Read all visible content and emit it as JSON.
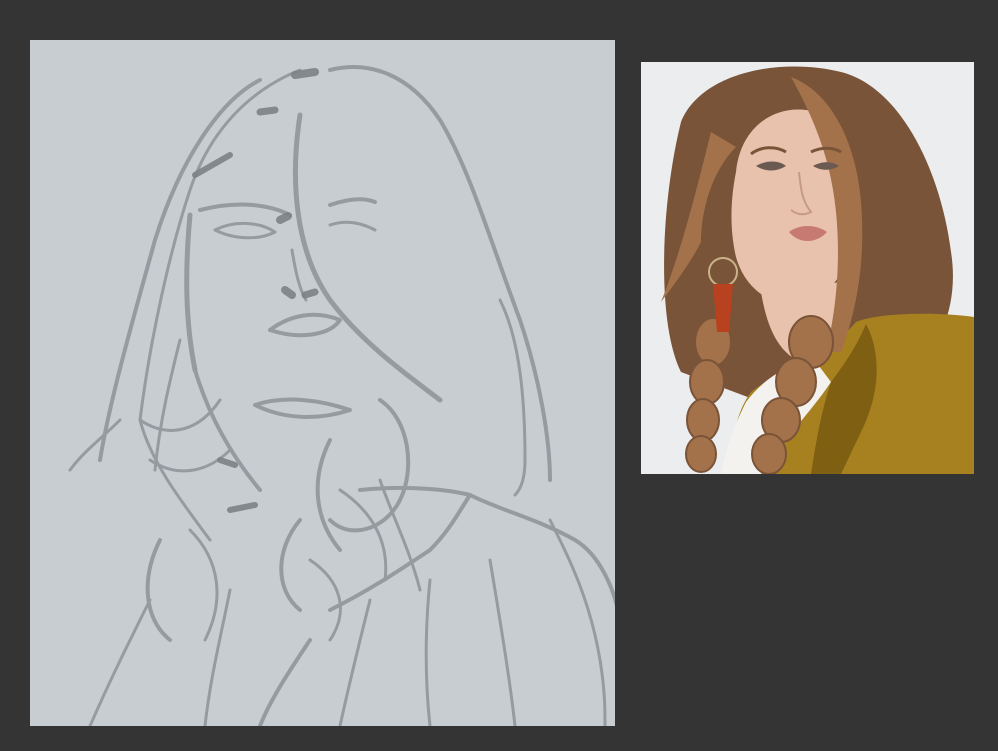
{
  "app": {
    "colors": {
      "background": "#343434",
      "canvas": "#c7cdd1",
      "sketch_stroke": "#8e9398",
      "sketch_stroke_dark": "#7d8286",
      "reference_background": "#ecedef",
      "reference_hair": "#7a5438",
      "reference_hair_light": "#a3724a",
      "reference_skin": "#e8c2ac",
      "reference_coat": "#a7801f",
      "reference_coat_shadow": "#7f5f12",
      "reference_shirt": "#f4f2ee",
      "reference_earring": "#b8411f",
      "reference_lips": "#c77a72"
    },
    "icons": {
      "canvas": "sketch-canvas-icon",
      "reference": "reference-photo-icon"
    }
  }
}
